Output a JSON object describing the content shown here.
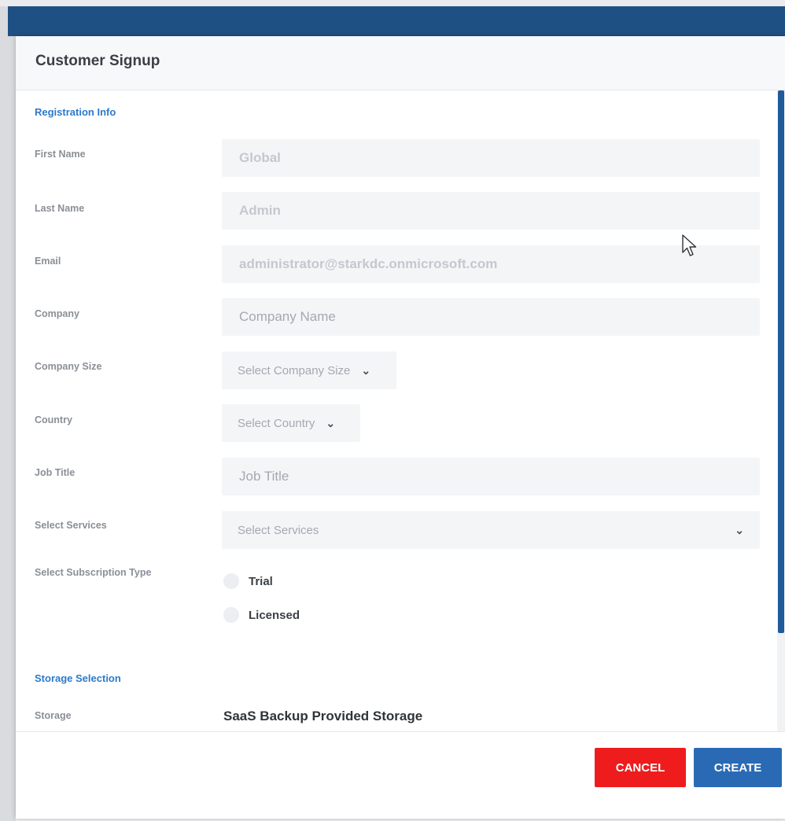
{
  "dialog": {
    "title": "Customer Signup"
  },
  "sections": {
    "registration": "Registration Info",
    "storage": "Storage Selection"
  },
  "fields": {
    "first_name": {
      "label": "First Name",
      "value": "Global"
    },
    "last_name": {
      "label": "Last Name",
      "value": "Admin"
    },
    "email": {
      "label": "Email",
      "value": "administrator@starkdc.onmicrosoft.com"
    },
    "company": {
      "label": "Company",
      "placeholder": "Company Name"
    },
    "company_size": {
      "label": "Company Size",
      "selected": "Select Company Size"
    },
    "country": {
      "label": "Country",
      "selected": "Select Country"
    },
    "job_title": {
      "label": "Job Title",
      "placeholder": "Job Title"
    },
    "services": {
      "label": "Select Services",
      "selected": "Select Services"
    },
    "subscription": {
      "label": "Select Subscription Type",
      "options": [
        "Trial",
        "Licensed"
      ]
    },
    "storage": {
      "label": "Storage",
      "value": "SaaS Backup Provided Storage"
    }
  },
  "footer": {
    "cancel_label": "CANCEL",
    "create_label": "CREATE"
  },
  "icons": {
    "dropdown": "chevron-down-icon",
    "pointer": "mouse-cursor-icon"
  },
  "colors": {
    "topbar": "#1f5084",
    "section_title": "#2c7ac9",
    "cancel": "#ee1c1c",
    "create": "#2a6ab5"
  }
}
